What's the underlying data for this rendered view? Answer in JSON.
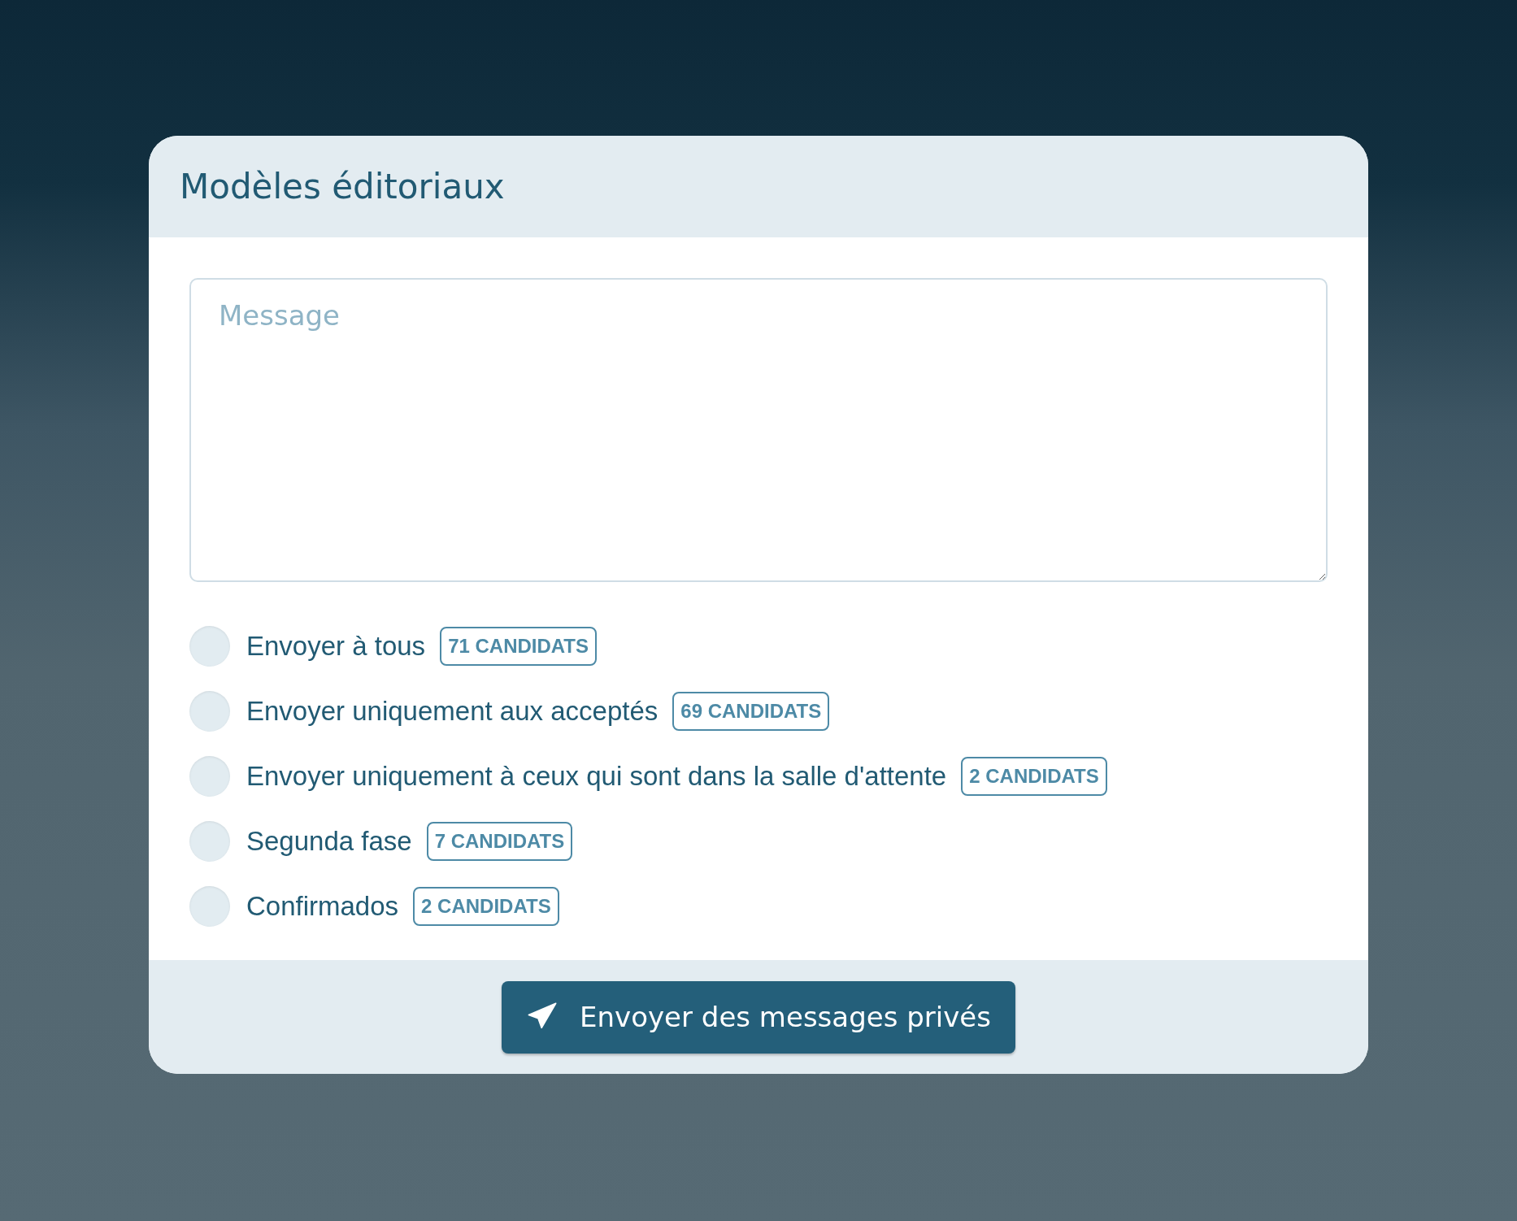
{
  "panel": {
    "title": "Modèles éditoriaux"
  },
  "message": {
    "placeholder": "Message"
  },
  "options": [
    {
      "label": "Envoyer à tous",
      "badge": "71 CANDIDATS",
      "selected": false
    },
    {
      "label": "Envoyer uniquement aux acceptés",
      "badge": "69 CANDIDATS",
      "selected": false
    },
    {
      "label": "Envoyer uniquement à ceux qui sont dans la salle d'attente",
      "badge": "2 CANDIDATS",
      "selected": false
    },
    {
      "label": "Segunda fase",
      "badge": "7 CANDIDATS",
      "selected": false
    },
    {
      "label": "Confirmados",
      "badge": "2 CANDIDATS",
      "selected": false
    }
  ],
  "send_button": {
    "label": "Envoyer des messages privés"
  }
}
